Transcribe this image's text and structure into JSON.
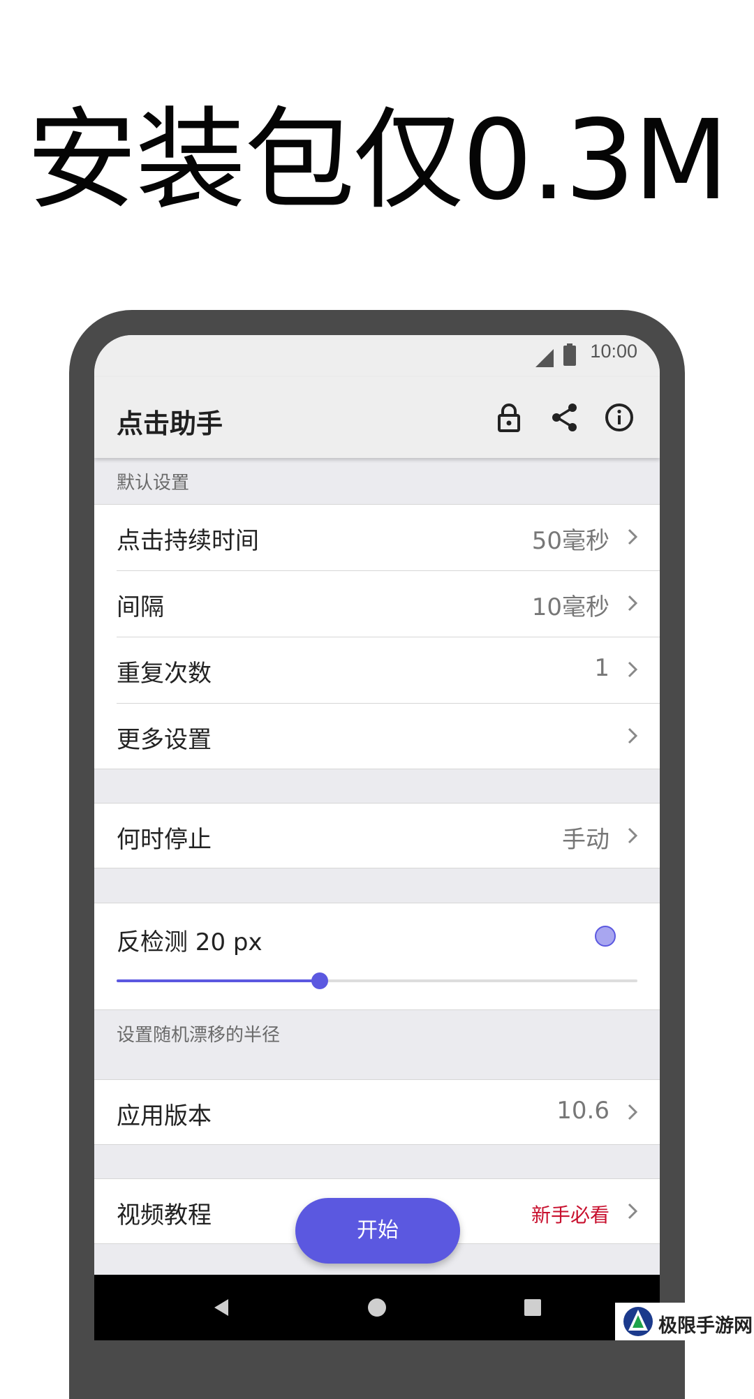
{
  "headline": "安装包仅0.3M",
  "status_bar": {
    "time": "10:00"
  },
  "app_bar": {
    "title": "点击助手",
    "icons": [
      "lock-icon",
      "share-icon",
      "info-icon"
    ]
  },
  "sections": {
    "default_settings_label": "默认设置",
    "slider_hint": "设置随机漂移的半径"
  },
  "rows": {
    "duration": {
      "label": "点击持续时间",
      "value": "50毫秒"
    },
    "interval": {
      "label": "间隔",
      "value": "10毫秒"
    },
    "repeat": {
      "label": "重复次数",
      "value": "1"
    },
    "more": {
      "label": "更多设置",
      "value": ""
    },
    "stop": {
      "label": "何时停止",
      "value": "手动"
    },
    "version": {
      "label": "应用版本",
      "value": "10.6"
    },
    "tutorial": {
      "label": "视频教程",
      "value": "新手必看"
    }
  },
  "anti_detect": {
    "label": "反检测 20 px",
    "slider_fraction": 0.39
  },
  "fab": {
    "label": "开始"
  },
  "navbar": {
    "icons": [
      "back-icon",
      "home-icon",
      "recents-icon"
    ]
  },
  "watermark": {
    "text": "极限手游网"
  },
  "colors": {
    "accent": "#5b58e0",
    "tutorial_value": "#c8102e",
    "appbar_bg": "#eeeeee",
    "list_bg": "#ebebef",
    "device_frame": "#4a4a4a"
  }
}
